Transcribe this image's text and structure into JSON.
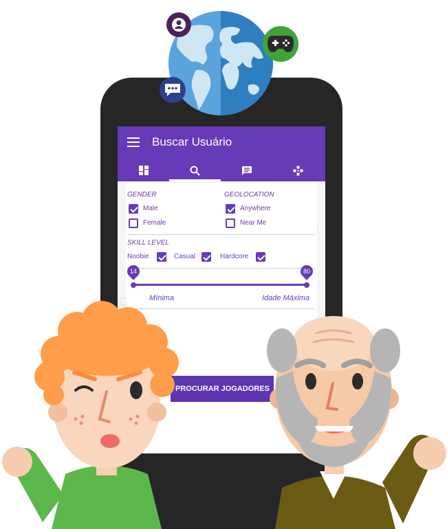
{
  "app": {
    "title": "Buscar Usuário"
  },
  "tabs": [
    {
      "icon": "dashboard-icon"
    },
    {
      "icon": "search-icon"
    },
    {
      "icon": "chat-icon"
    },
    {
      "icon": "gamepad-icon"
    }
  ],
  "gender": {
    "label": "GENDER",
    "options": [
      {
        "label": "Male",
        "checked": true
      },
      {
        "label": "Female",
        "checked": false
      }
    ]
  },
  "geolocation": {
    "label": "GEOLOCATION",
    "options": [
      {
        "label": "Anywhere",
        "checked": true
      },
      {
        "label": "Near Me",
        "checked": false
      }
    ]
  },
  "skill": {
    "label": "SKILL LEVEL",
    "options": [
      {
        "label": "Noobie",
        "checked": true
      },
      {
        "label": "Casual",
        "checked": true
      },
      {
        "label": "Hardcore",
        "checked": true
      }
    ]
  },
  "age": {
    "min": "14",
    "max": "80",
    "min_label": "Mínima",
    "max_label": "Idade Máxima"
  },
  "search_button": "PROCURAR JOGADORES",
  "colors": {
    "primary": "#673ab7",
    "button": "#5e35b1",
    "phone": "#262626"
  }
}
